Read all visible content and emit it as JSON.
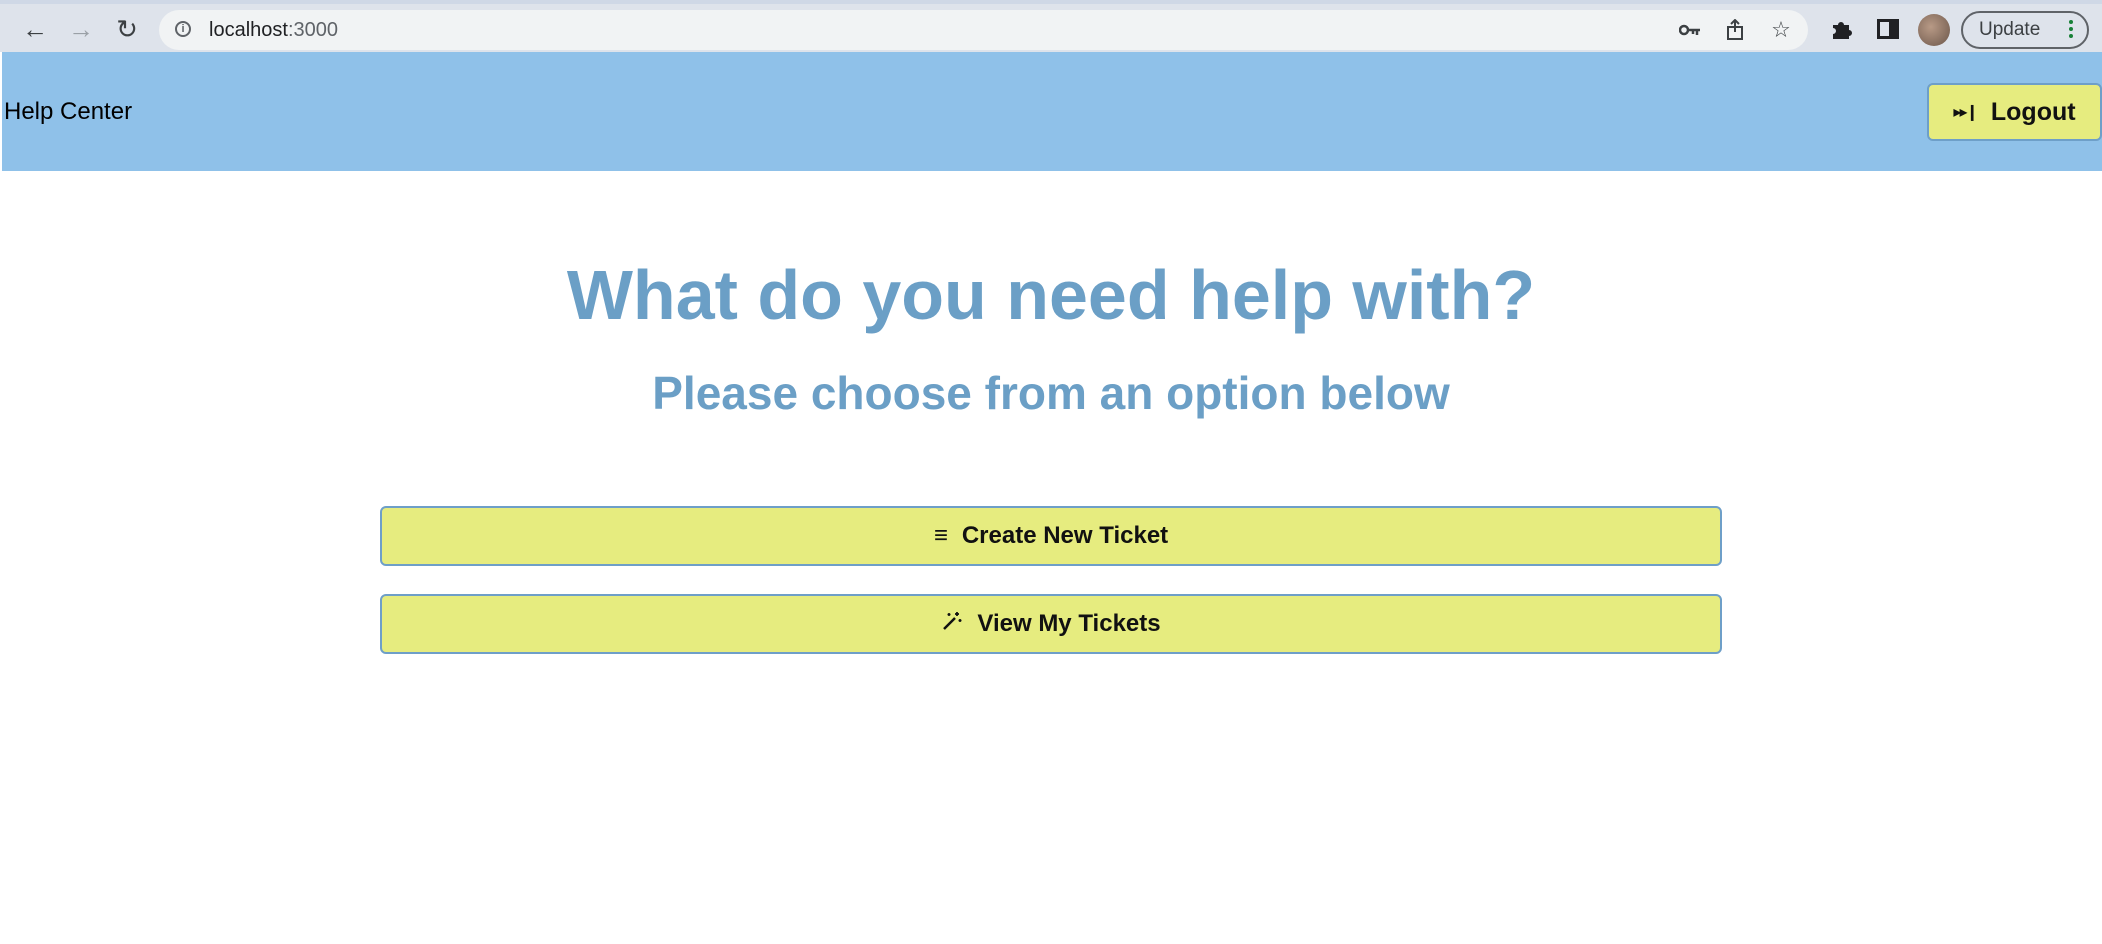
{
  "browser": {
    "url": "localhost:3000",
    "url_host": "localhost",
    "url_port": ":3000",
    "update_label": "Update"
  },
  "header": {
    "title": "Help Center",
    "logout_label": "Logout"
  },
  "main": {
    "heading": "What do you need help with?",
    "subheading": "Please choose from an option below",
    "options": [
      {
        "label": "Create New Ticket",
        "icon": "list-icon"
      },
      {
        "label": "View My Tickets",
        "icon": "magic-wand-icon"
      }
    ]
  },
  "colors": {
    "header_bg": "#8fc1e9",
    "button_bg": "#e6ec7f",
    "heading": "#6b9fc6"
  }
}
